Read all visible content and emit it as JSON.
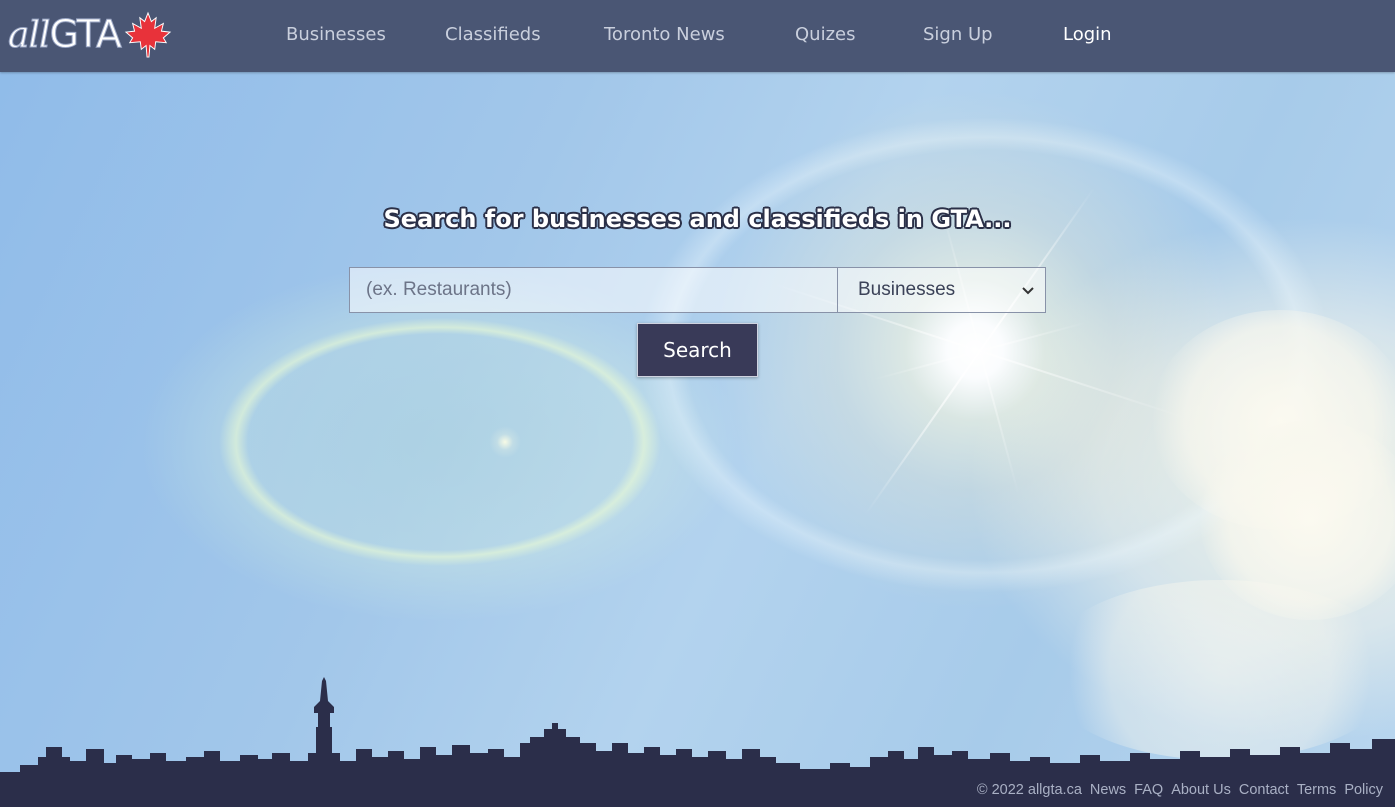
{
  "logo": {
    "prefix": "all",
    "main": "GTA"
  },
  "nav": [
    {
      "label": "Businesses"
    },
    {
      "label": "Classifieds"
    },
    {
      "label": "Toronto News"
    },
    {
      "label": "Quizes"
    },
    {
      "label": "Sign Up"
    },
    {
      "label": "Login"
    }
  ],
  "hero": {
    "title": "Search for businesses and classifieds in GTA...",
    "search_placeholder": "(ex. Restaurants)",
    "search_value": "",
    "category_selected": "Businesses",
    "search_button": "Search"
  },
  "footer": {
    "copyright": "© 2022 allgta.ca",
    "links": [
      "News",
      "FAQ",
      "About Us",
      "Contact",
      "Terms",
      "Policy"
    ]
  },
  "colors": {
    "navbar": "#4a5674",
    "button": "#393a58",
    "skyline": "#2b2e4a",
    "maple": "#e8323a"
  },
  "icons": {
    "logo_leaf": "maple-leaf-icon",
    "select_arrow": "chevron-down-icon"
  }
}
